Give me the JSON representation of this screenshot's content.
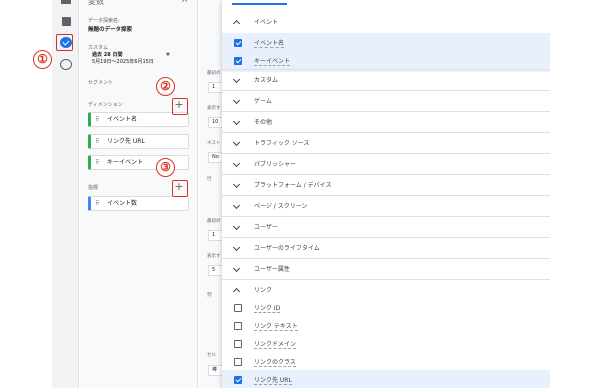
{
  "rail": {
    "icons": [
      "home-icon",
      "reports-icon",
      "explore-icon",
      "advertising-icon"
    ]
  },
  "panel": {
    "title": "変数",
    "close_icon": "×",
    "exploration_name_label": "データ探索名:",
    "exploration_name": "無題のデータ探索",
    "date_custom": "カスタム",
    "date_range_label": "過去 28 日間",
    "date_range": "5月19日～2025年6月15日",
    "segment_label": "セグメント",
    "dimension_label": "ディメンション",
    "dimensions": [
      "イベント名",
      "リンク先 URL",
      "キーイベント"
    ],
    "metric_label": "指標",
    "metrics": [
      "イベント数"
    ]
  },
  "settings": {
    "labels": [
      "最初の",
      "表示す",
      "ネスト",
      "行",
      "最初の",
      "表示す",
      "列",
      "値",
      "セル"
    ],
    "boxes": [
      "1",
      "10",
      "No",
      "1",
      "5",
      "棒"
    ]
  },
  "annotations": [
    "①",
    "②",
    "③"
  ],
  "dropdown": {
    "items": [
      {
        "type": "group",
        "label": "イベント",
        "expanded": true
      },
      {
        "type": "item",
        "label": "イベント名",
        "checked": true
      },
      {
        "type": "item",
        "label": "キーイベント",
        "checked": true
      },
      {
        "type": "group",
        "label": "カスタム",
        "expanded": false
      },
      {
        "type": "group",
        "label": "ゲーム",
        "expanded": false
      },
      {
        "type": "group",
        "label": "その他",
        "expanded": false
      },
      {
        "type": "group",
        "label": "トラフィック ソース",
        "expanded": false
      },
      {
        "type": "group",
        "label": "パブリッシャー",
        "expanded": false
      },
      {
        "type": "group",
        "label": "プラットフォーム / デバイス",
        "expanded": false
      },
      {
        "type": "group",
        "label": "ページ / スクリーン",
        "expanded": false
      },
      {
        "type": "group",
        "label": "ユーザー",
        "expanded": false
      },
      {
        "type": "group",
        "label": "ユーザーのライフタイム",
        "expanded": false
      },
      {
        "type": "group",
        "label": "ユーザー属性",
        "expanded": false
      },
      {
        "type": "group",
        "label": "リンク",
        "expanded": true
      },
      {
        "type": "item",
        "label": "リンク ID",
        "checked": false
      },
      {
        "type": "item",
        "label": "リンク テキスト",
        "checked": false
      },
      {
        "type": "item",
        "label": "リンクドメイン",
        "checked": false
      },
      {
        "type": "item",
        "label": "リンクのクラス",
        "checked": false
      },
      {
        "type": "item",
        "label": "リンク先 URL",
        "checked": true
      }
    ]
  },
  "colors": {
    "accent": "#1a73e8",
    "annotation": "#d93025",
    "selected_row": "#e8f0fe"
  }
}
